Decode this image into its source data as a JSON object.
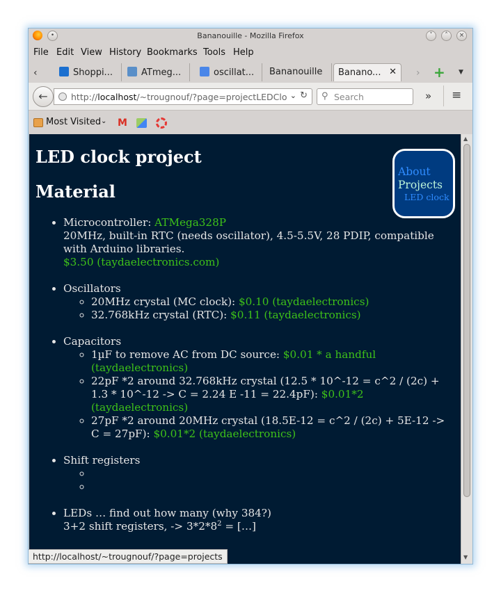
{
  "window": {
    "title": "Bananouille - Mozilla Firefox"
  },
  "menu": [
    "File",
    "Edit",
    "View",
    "History",
    "Bookmarks",
    "Tools",
    "Help"
  ],
  "tabs": [
    {
      "label": "Shoppi...",
      "icon": "shopping-icon"
    },
    {
      "label": "ATmeg...",
      "icon": "pen-icon"
    },
    {
      "label": "oscillat...",
      "icon": "google-icon"
    },
    {
      "label": "Bananouille",
      "icon": ""
    },
    {
      "label": "Banano...",
      "icon": "",
      "active": true
    }
  ],
  "nav": {
    "url_prefix": "http://",
    "url_host": "localhost",
    "url_rest": "/~trougnouf/?page=projectLEDClo",
    "search_placeholder": "Search"
  },
  "bookmarks": {
    "most_visited": "Most Visited"
  },
  "page": {
    "title": "LED clock project",
    "section": "Material",
    "sidenav": {
      "about": "About",
      "projects": "Projects",
      "led_clock": "LED clock"
    },
    "items": {
      "mc_label": "Microcontroller: ",
      "mc_link": "ATMega328P",
      "mc_desc": "20MHz, built-in RTC (needs oscillator), 4.5-5.5V, 28 PDIP, compatible with Arduino libraries.",
      "mc_price": "$3.50 (taydaelectronics.com)",
      "osc_label": "Oscillators",
      "osc1_text": "20MHz crystal (MC clock): ",
      "osc1_price": "$0.10 (taydaelectronics)",
      "osc2_text": "32.768kHz crystal (RTC): ",
      "osc2_price": "$0.11 (taydaelectronics)",
      "cap_label": "Capacitors",
      "cap1_text": "1µF to remove AC from DC source: ",
      "cap1_price": "$0.01 * a handful (taydaelectronics)",
      "cap2_text": "22pF *2 around 32.768kHz crystal (12.5 * 10^-12 = c^2 / (2c) + 1.3 * 10^-12 -> C = 2.24 E -11 = 22.4pF): ",
      "cap2_price": "$0.01*2 (taydaelectronics)",
      "cap3_text": "27pF *2 around 20MHz crystal (18.5E-12 = c^2 / (2c) + 5E-12 -> C = 27pF): ",
      "cap3_price": "$0.01*2 (taydaelectronics)",
      "shift_label": "Shift registers",
      "leds_label": "LEDs … find out how many (why 384?)",
      "leds_calc_a": "3+2 shift registers, -> 3*2*8",
      "leds_calc_sup": "2",
      "leds_calc_b": " = […]"
    }
  },
  "status_url": "http://localhost/~trougnouf/?page=projects",
  "colors": {
    "page_bg": "#001b33",
    "link_green": "#3ec219",
    "nav_blue": "#2f8cff",
    "sidenav_bg": "#003b80"
  }
}
